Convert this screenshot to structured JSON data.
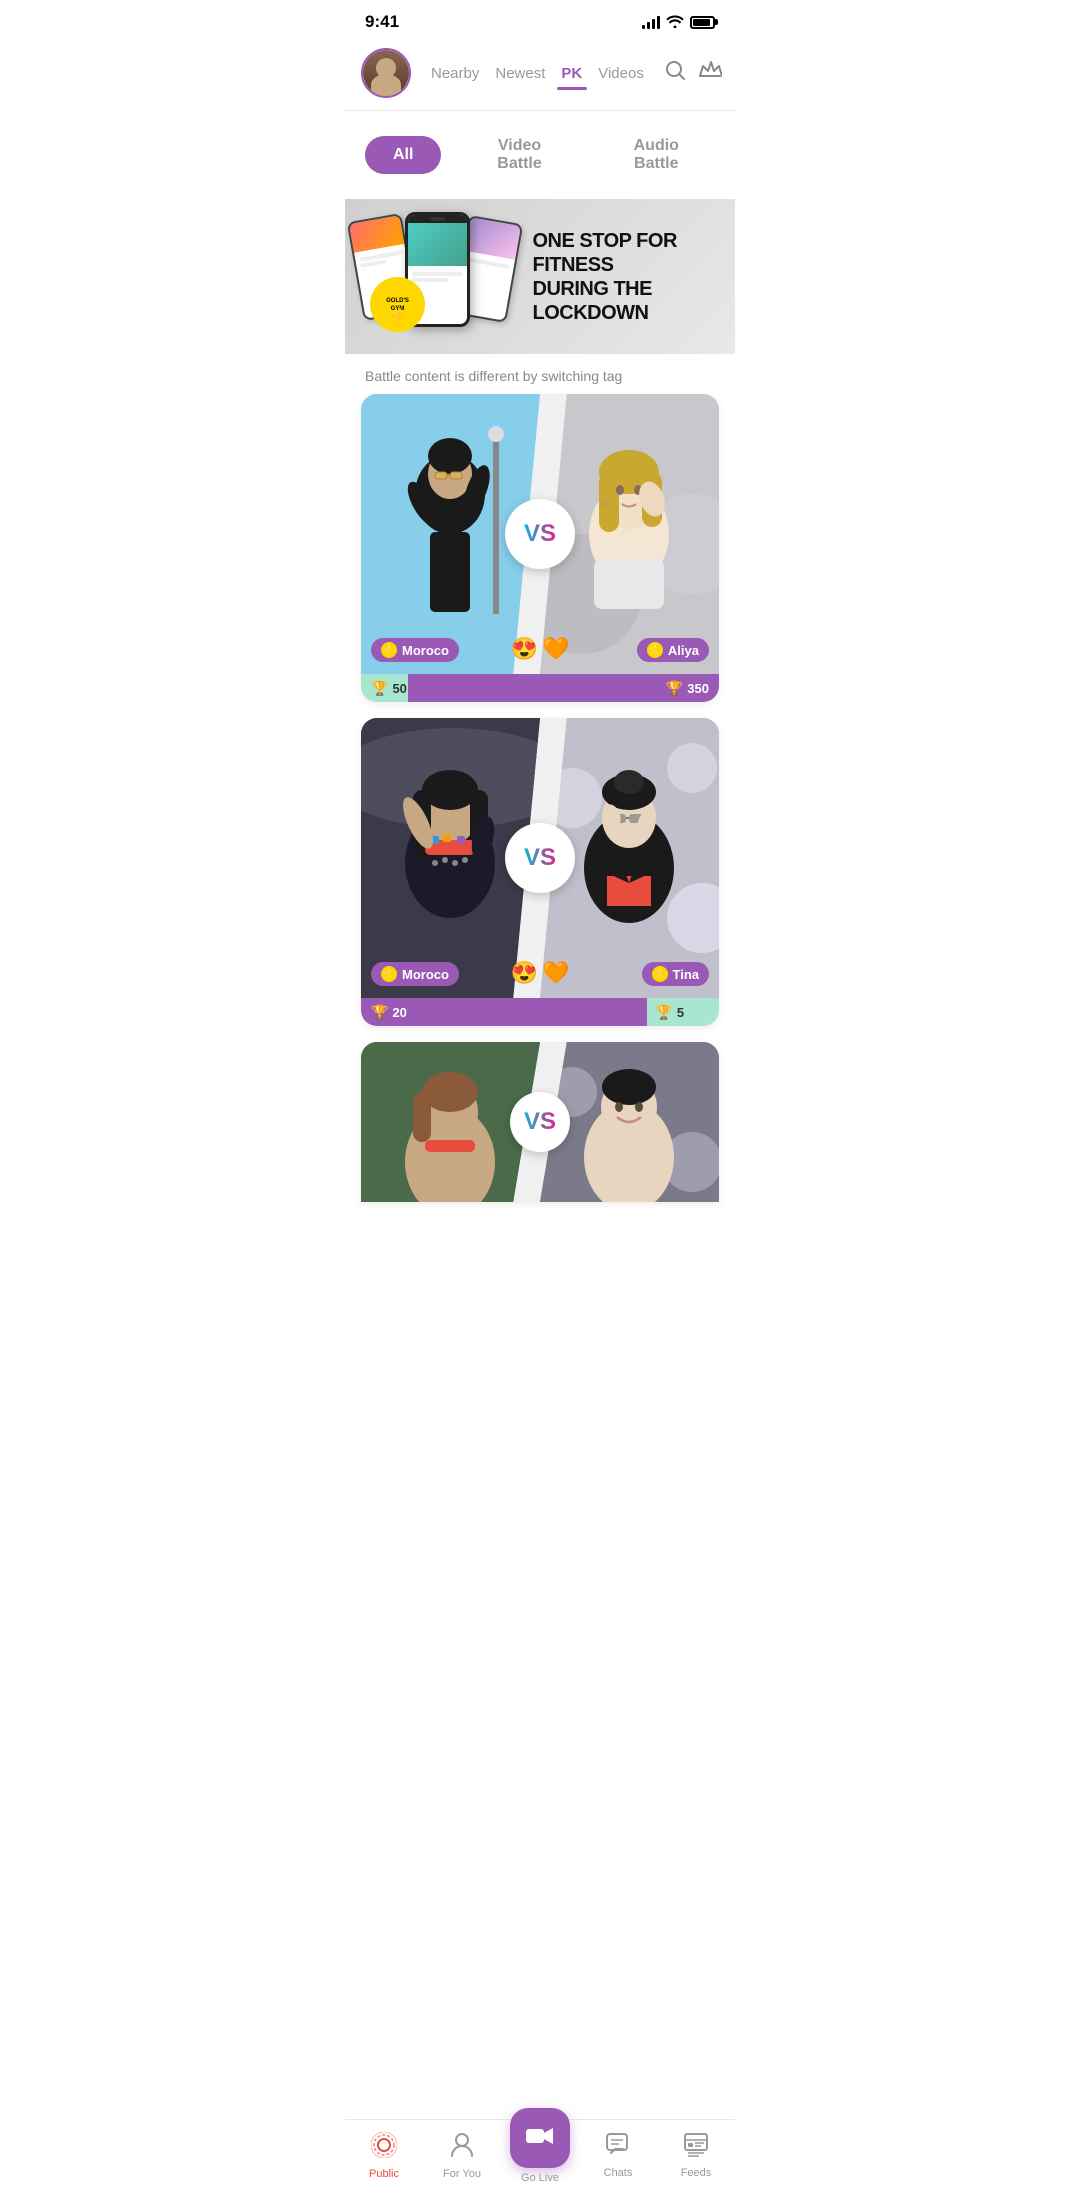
{
  "status": {
    "time": "9:41"
  },
  "header": {
    "nav_items": [
      {
        "label": "Nearby",
        "active": false
      },
      {
        "label": "Newest",
        "active": false
      },
      {
        "label": "PK",
        "active": true
      },
      {
        "label": "Videos",
        "active": false
      }
    ]
  },
  "filter": {
    "tabs": [
      {
        "label": "All",
        "active": true
      },
      {
        "label": "Video Battle",
        "active": false
      },
      {
        "label": "Audio Battle",
        "active": false
      }
    ]
  },
  "banner": {
    "text_line1": "ONE STOP FOR FITNESS",
    "text_line2": "DURING THE LOCKDOWN",
    "gym_label": "GOLD'S GYM"
  },
  "battle_info": {
    "text": "Battle content is different by switching tag"
  },
  "battles": [
    {
      "left_user": "Moroco",
      "right_user": "Aliya",
      "left_score": 50,
      "right_score": 350,
      "left_progress_pct": 13,
      "emoji": "😍"
    },
    {
      "left_user": "Moroco",
      "right_user": "Tina",
      "left_score": 20,
      "right_score": 5,
      "left_progress_pct": 80,
      "emoji": "😍"
    }
  ],
  "bottom_nav": {
    "tabs": [
      {
        "label": "Public",
        "icon": "📡",
        "active": true
      },
      {
        "label": "For You",
        "icon": "👤",
        "active": false
      },
      {
        "label": "Go Live",
        "icon": "📹",
        "active": false,
        "center": true
      },
      {
        "label": "Chats",
        "icon": "💬",
        "active": false
      },
      {
        "label": "Feeds",
        "icon": "📋",
        "active": false
      }
    ]
  },
  "colors": {
    "purple": "#9b59b6",
    "teal": "#00bcd4",
    "pink": "#e91e8c",
    "red": "#e74c3c",
    "green": "#a8e6cf",
    "gold": "#FFD700"
  }
}
